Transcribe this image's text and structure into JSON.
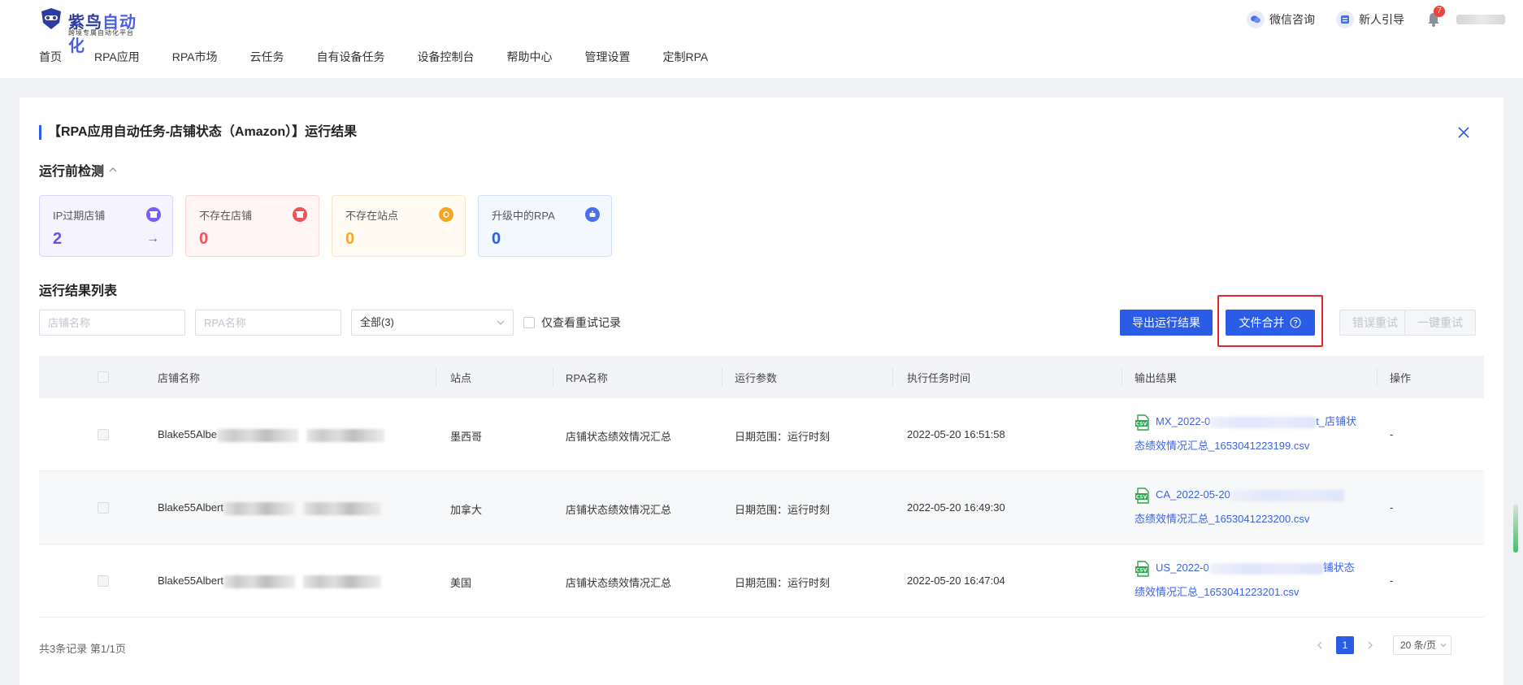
{
  "brand": {
    "name_part1": "紫鸟",
    "name_part2": "自动化",
    "tagline": "跨境专属自动化平台"
  },
  "top_right": {
    "wechat": "微信咨询",
    "guide": "新人引导",
    "notification_count": "7"
  },
  "nav": [
    "首页",
    "RPA应用",
    "RPA市场",
    "云任务",
    "自有设备任务",
    "设备控制台",
    "帮助中心",
    "管理设置",
    "定制RPA"
  ],
  "panel": {
    "title": "【RPA应用自动任务-店铺状态（Amazon）】运行结果",
    "pre_check_title": "运行前检测",
    "results_title": "运行结果列表"
  },
  "stats": [
    {
      "label": "IP过期店铺",
      "value": "2",
      "color": "#6a4ee8",
      "bg": "#f5f3fe",
      "border": "#dcd5fb"
    },
    {
      "label": "不存在店铺",
      "value": "0",
      "color": "#f0525c",
      "bg": "#fff5f5",
      "border": "#fbd5d7"
    },
    {
      "label": "不存在站点",
      "value": "0",
      "color": "#f5a623",
      "bg": "#fffaf2",
      "border": "#fae6c6"
    },
    {
      "label": "升级中的RPA",
      "value": "0",
      "color": "#2b5ce6",
      "bg": "#f3f7fe",
      "border": "#d3e0fa"
    }
  ],
  "filters": {
    "shop_placeholder": "店铺名称",
    "rpa_placeholder": "RPA名称",
    "status_value": "全部(3)",
    "retry_only_label": "仅查看重试记录"
  },
  "buttons": {
    "export": "导出运行结果",
    "merge": "文件合并",
    "retry_errors": "错误重试",
    "retry_all": "一键重试"
  },
  "table": {
    "headers": [
      "店铺名称",
      "站点",
      "RPA名称",
      "运行参数",
      "执行任务时间",
      "输出结果",
      "操作"
    ],
    "rows": [
      {
        "shop": "Blake55Albe",
        "site": "墨西哥",
        "rpa": "店铺状态绩效情况汇总",
        "params": "日期范围：运行时刻",
        "time": "2022-05-20 16:51:58",
        "file_line1_start": "MX_2022-0",
        "file_line1_end": "t_店铺状",
        "file_line2": "态绩效情况汇总_1653041223199.csv",
        "op": "-"
      },
      {
        "shop": "Blake55Albert",
        "site": "加拿大",
        "rpa": "店铺状态绩效情况汇总",
        "params": "日期范围：运行时刻",
        "time": "2022-05-20 16:49:30",
        "file_line1_start": "CA_2022-05-20",
        "file_line1_end": "",
        "file_line2": "态绩效情况汇总_1653041223200.csv",
        "op": "-"
      },
      {
        "shop": "Blake55Albert",
        "site": "美国",
        "rpa": "店铺状态绩效情况汇总",
        "params": "日期范围：运行时刻",
        "time": "2022-05-20 16:47:04",
        "file_line1_start": "US_2022-0",
        "file_line1_end": "铺状态",
        "file_line2": "绩效情况汇总_1653041223201.csv",
        "op": "-"
      }
    ]
  },
  "pagination": {
    "summary": "共3条记录 第1/1页",
    "current": "1",
    "page_size": "20 条/页"
  }
}
